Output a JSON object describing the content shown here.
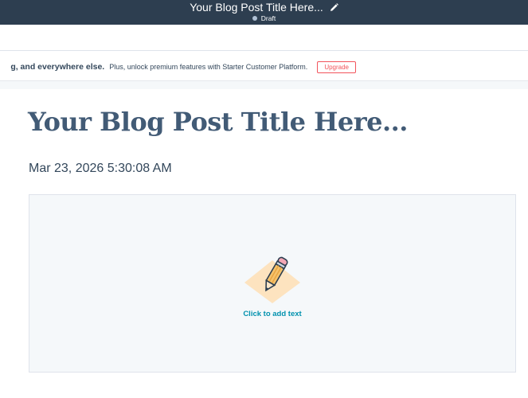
{
  "header": {
    "title": "Your Blog Post Title Here...",
    "status": "Draft",
    "edit_icon": "pencil-icon"
  },
  "banner": {
    "strong_text": "g, and everywhere else.",
    "message": "Plus, unlock premium features with Starter Customer Platform.",
    "upgrade_label": "Upgrade"
  },
  "post": {
    "title": "Your Blog Post Title Here...",
    "date": "Mar 23, 2026 5:30:08 AM",
    "placeholder": "Click to add text",
    "placeholder_icon": "pencil-illustration"
  },
  "colors": {
    "header_bg": "#2d3e50",
    "title_color": "#425b76",
    "link_color": "#0091ae",
    "upgrade_accent": "#f2545b",
    "editor_bg": "#f5f8fa"
  }
}
